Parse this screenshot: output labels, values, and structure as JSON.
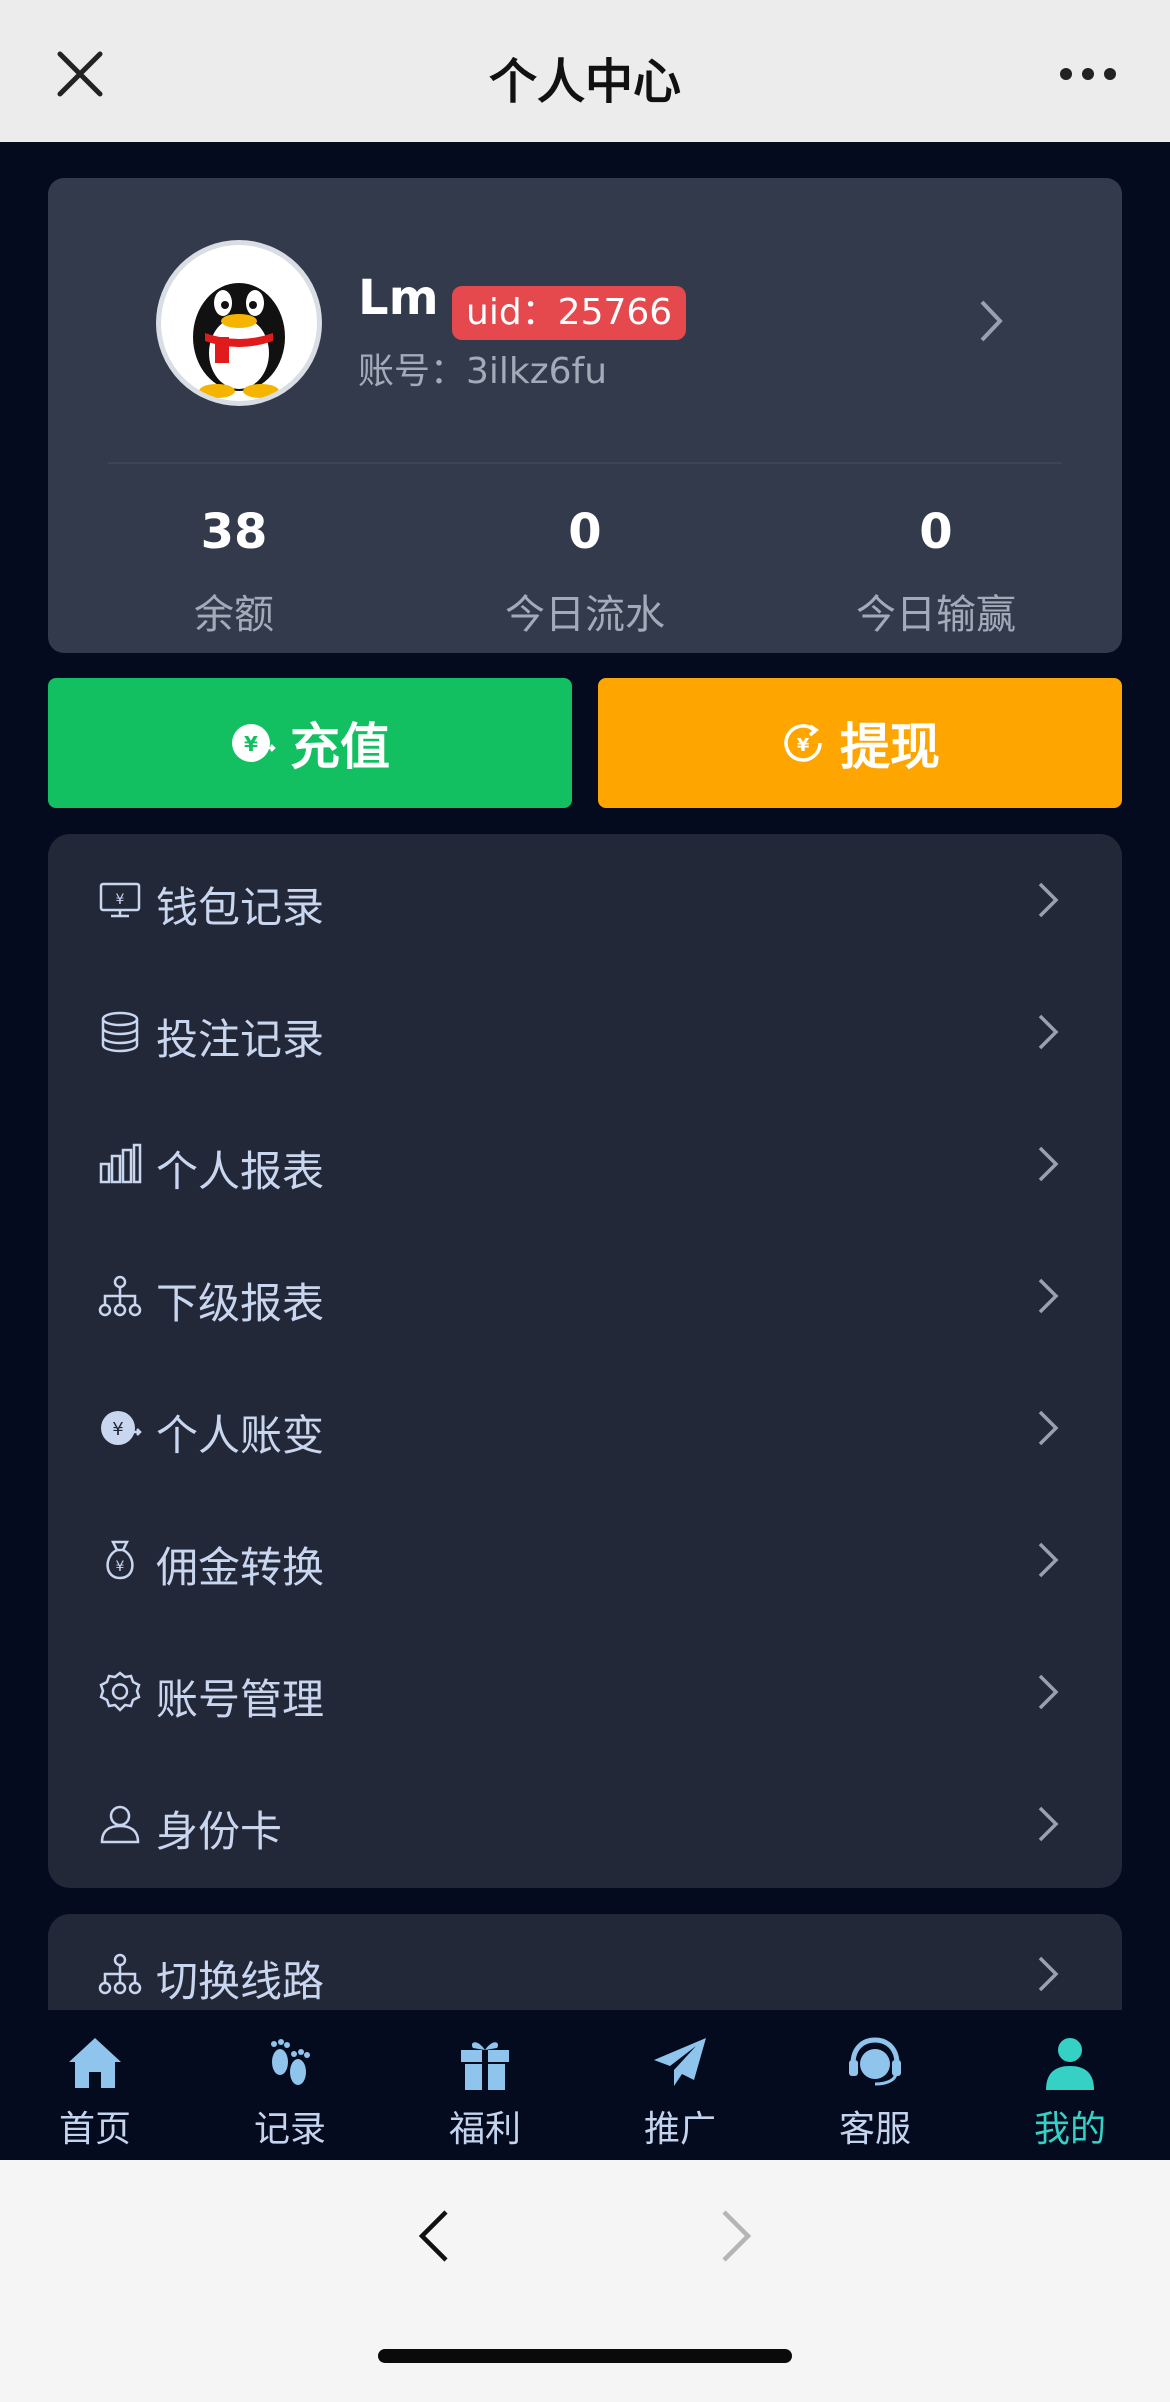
{
  "header": {
    "title": "个人中心"
  },
  "profile": {
    "name": "Lm",
    "uid": "uid：25766",
    "account": "账号：3ilkz6fu",
    "stats": [
      {
        "value": "38",
        "label": "余额"
      },
      {
        "value": "0",
        "label": "今日流水"
      },
      {
        "value": "0",
        "label": "今日输赢"
      }
    ]
  },
  "actions": {
    "recharge": "充值",
    "withdraw": "提现"
  },
  "menu": {
    "items": [
      {
        "label": "钱包记录",
        "icon": "wallet-monitor-icon"
      },
      {
        "label": "投注记录",
        "icon": "database-icon"
      },
      {
        "label": "个人报表",
        "icon": "bar-chart-icon"
      },
      {
        "label": "下级报表",
        "icon": "hierarchy-icon"
      },
      {
        "label": "个人账变",
        "icon": "yuan-exchange-icon"
      },
      {
        "label": "佣金转换",
        "icon": "money-bag-icon"
      },
      {
        "label": "账号管理",
        "icon": "gear-icon"
      },
      {
        "label": "身份卡",
        "icon": "user-icon"
      }
    ],
    "extra": {
      "label": "切换线路",
      "icon": "hierarchy-icon"
    }
  },
  "tabs": [
    {
      "label": "首页",
      "icon": "home-icon"
    },
    {
      "label": "记录",
      "icon": "footprint-icon"
    },
    {
      "label": "福利",
      "icon": "gift-icon"
    },
    {
      "label": "推广",
      "icon": "paper-plane-icon"
    },
    {
      "label": "客服",
      "icon": "headset-icon"
    },
    {
      "label": "我的",
      "icon": "person-icon",
      "active": true
    }
  ],
  "colors": {
    "accent": "#35d1c4",
    "recharge": "#13c061",
    "withdraw": "#fea500",
    "badge": "#e5484d"
  }
}
